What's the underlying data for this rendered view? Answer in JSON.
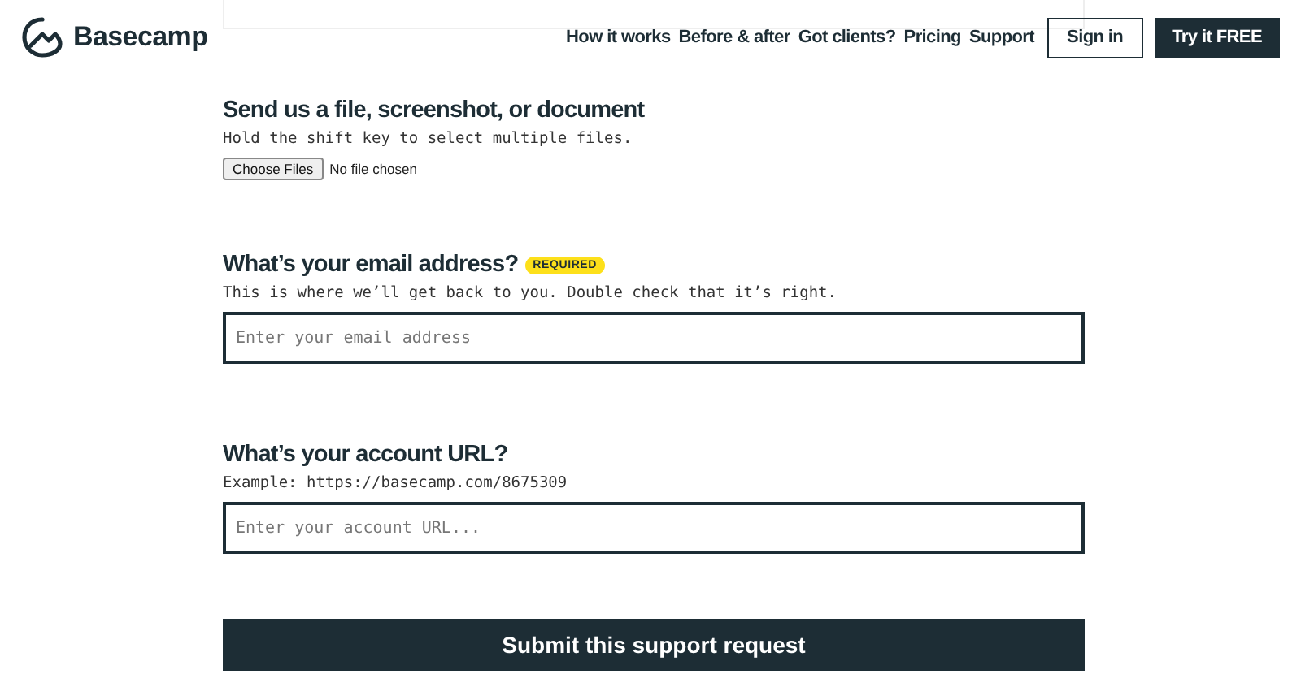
{
  "header": {
    "logo": "Basecamp",
    "nav": [
      "How it works",
      "Before & after",
      "Got clients?",
      "Pricing",
      "Support"
    ],
    "buttons": [
      {
        "label": "Sign in",
        "kind": "outline"
      },
      {
        "label": "Try it FREE",
        "kind": "solid"
      }
    ]
  },
  "sections": [
    {
      "kind": "file",
      "title": "Send us a file, screenshot, or document",
      "hint": "Hold the shift key to select multiple files.",
      "button": "Choose Files",
      "status": "No file chosen"
    },
    {
      "kind": "text",
      "title": "What’s your email address?",
      "badge": "REQUIRED",
      "hint": "This is where we’ll get back to you. Double check that it’s right.",
      "placeholder": "Enter your email address"
    },
    {
      "kind": "text",
      "title": "What’s your account URL?",
      "hint": "Example: https://basecamp.com/8675309",
      "placeholder": "Enter your account URL..."
    }
  ],
  "submit": "Submit this support request"
}
